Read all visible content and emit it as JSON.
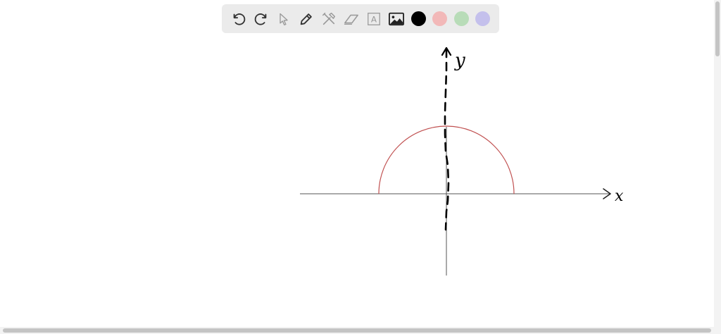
{
  "toolbar": {
    "tools": [
      {
        "name": "undo-icon"
      },
      {
        "name": "redo-icon"
      },
      {
        "name": "pointer-icon"
      },
      {
        "name": "pencil-icon"
      },
      {
        "name": "tools-icon"
      },
      {
        "name": "eraser-icon"
      },
      {
        "name": "text-icon",
        "glyph": "A"
      },
      {
        "name": "image-icon"
      }
    ],
    "colors": [
      {
        "name": "black",
        "hex": "#000000"
      },
      {
        "name": "red",
        "hex": "#f2b8b8"
      },
      {
        "name": "green",
        "hex": "#b8dcb8"
      },
      {
        "name": "purple",
        "hex": "#c4c0ec"
      }
    ]
  },
  "canvas": {
    "x_label": "x",
    "y_label": "y",
    "curve_color": "#c05050",
    "axis_color": "#555555",
    "ink_color": "#000000"
  }
}
